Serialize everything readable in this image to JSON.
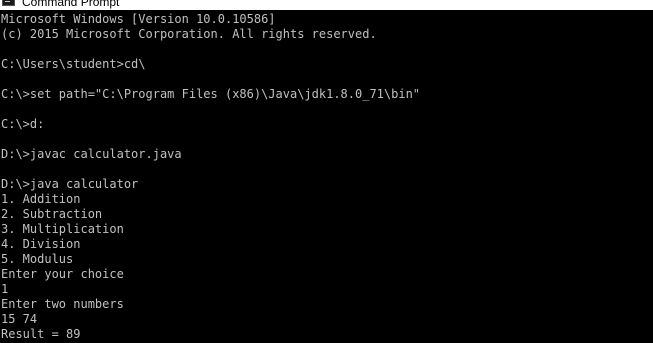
{
  "window": {
    "title": "Command Prompt",
    "icon": "cmd-icon"
  },
  "console": {
    "foreground": "#c0c0c0",
    "background": "#000000",
    "lines": [
      "Microsoft Windows [Version 10.0.10586]",
      "(c) 2015 Microsoft Corporation. All rights reserved.",
      "",
      "C:\\Users\\student>cd\\",
      "",
      "C:\\>set path=\"C:\\Program Files (x86)\\Java\\jdk1.8.0_71\\bin\"",
      "",
      "C:\\>d:",
      "",
      "D:\\>javac calculator.java",
      "",
      "D:\\>java calculator",
      "1. Addition",
      "2. Subtraction",
      "3. Multiplication",
      "4. Division",
      "5. Modulus",
      "Enter your choice",
      "1",
      "Enter two numbers",
      "15 74",
      "Result = 89"
    ]
  }
}
